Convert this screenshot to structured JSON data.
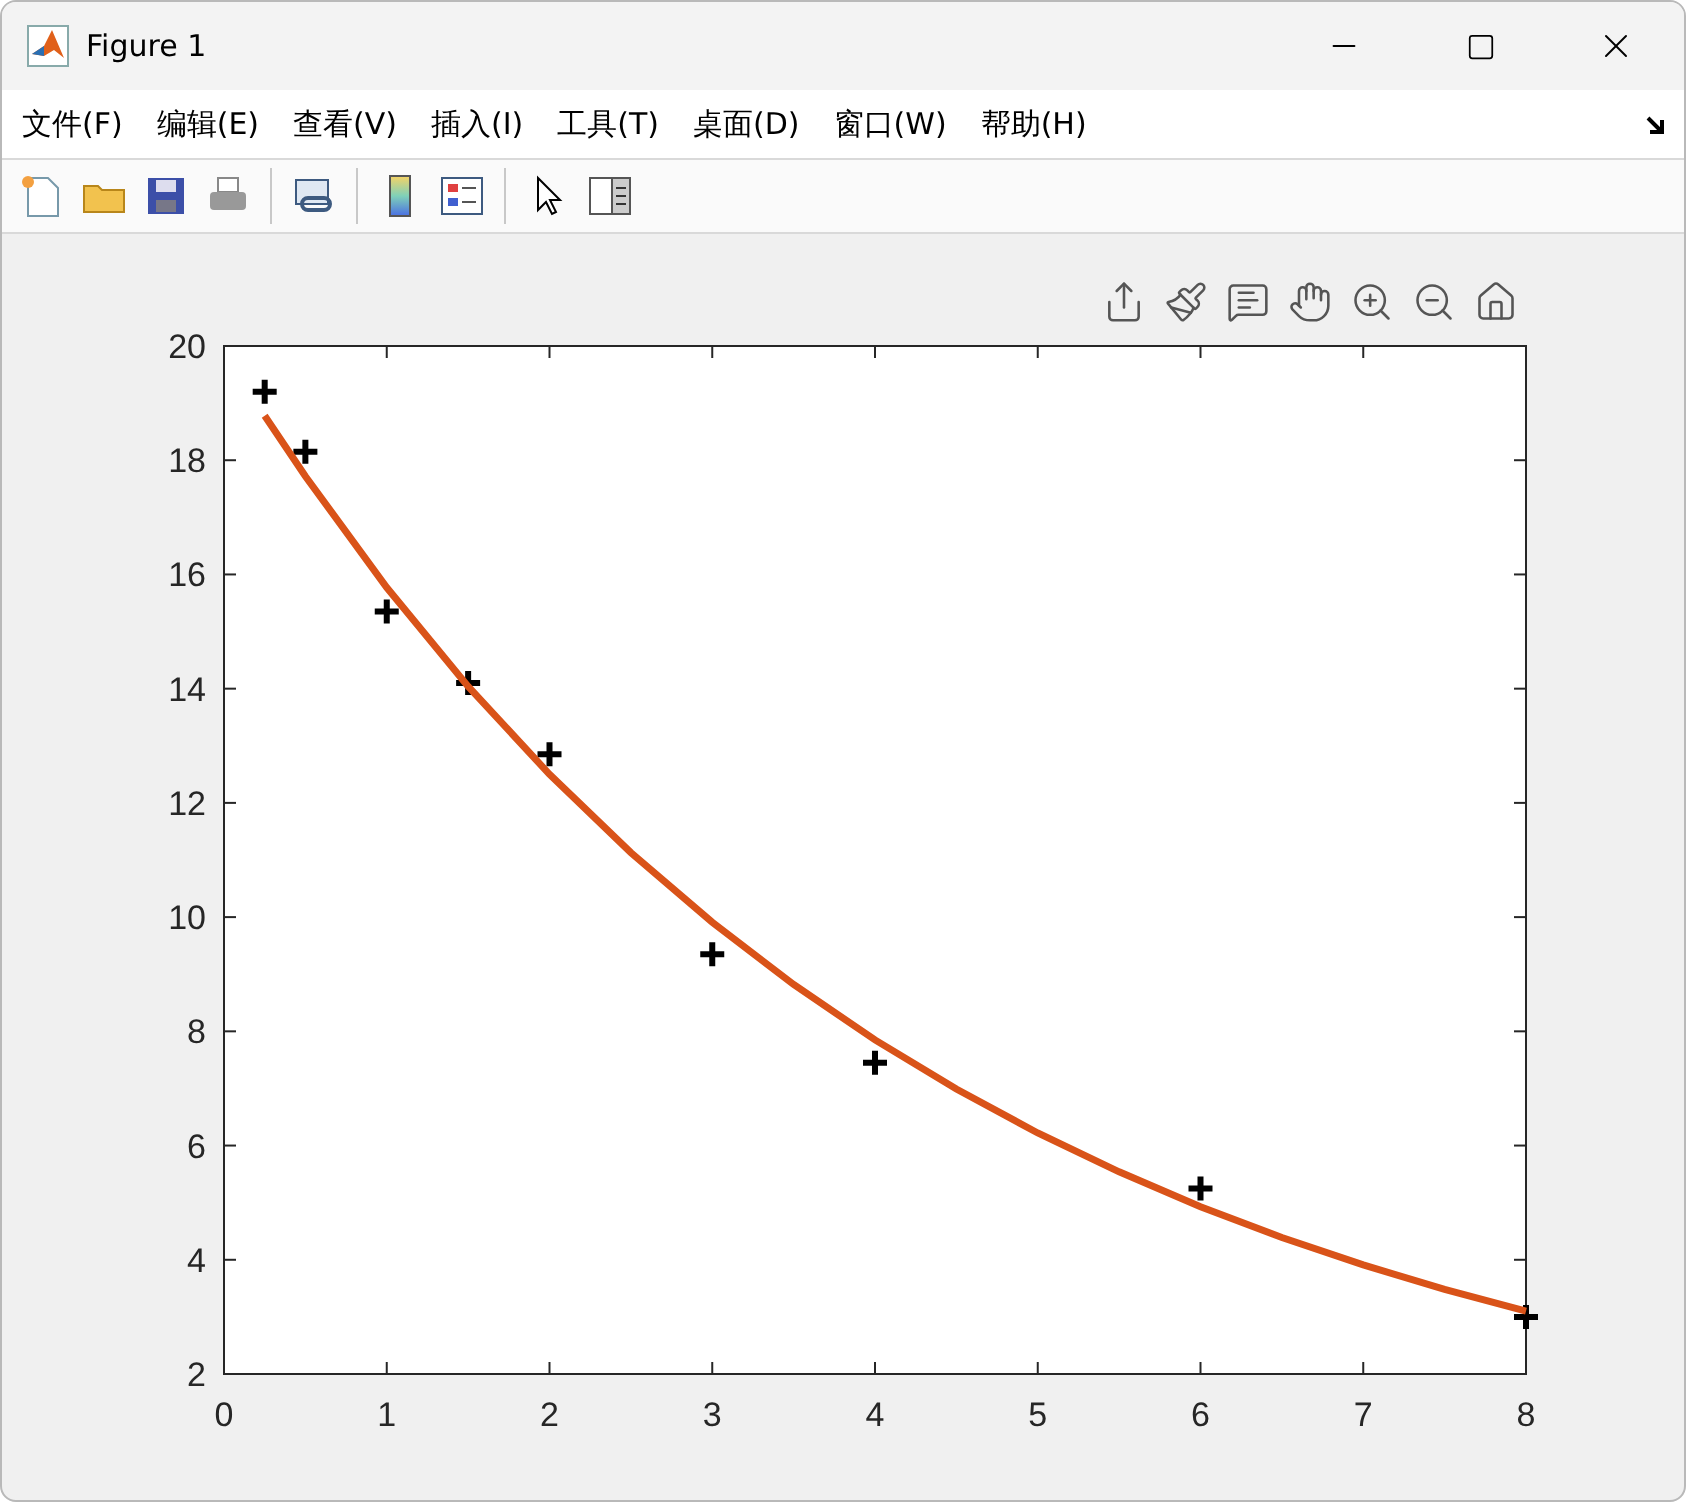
{
  "window": {
    "title": "Figure 1"
  },
  "menu": [
    "文件(F)",
    "编辑(E)",
    "查看(V)",
    "插入(I)",
    "工具(T)",
    "桌面(D)",
    "窗口(W)",
    "帮助(H)"
  ],
  "plot": {
    "chart_data": {
      "type": "scatter",
      "xlim": [
        0,
        8
      ],
      "ylim": [
        2,
        20
      ],
      "xticks": [
        0,
        1,
        2,
        3,
        4,
        5,
        6,
        7,
        8
      ],
      "yticks": [
        2,
        4,
        6,
        8,
        10,
        12,
        14,
        16,
        18,
        20
      ],
      "series": [
        {
          "color": "#000000",
          "x": [
            0.25,
            0.5,
            1,
            1.5,
            2,
            3,
            4,
            6,
            8
          ],
          "values": [
            19.2,
            18.15,
            15.35,
            14.1,
            12.85,
            9.35,
            7.45,
            5.25,
            3.0
          ]
        },
        {
          "type": "line",
          "color": "#d95319",
          "x": [
            0.25,
            0.5,
            1,
            1.5,
            2,
            2.5,
            3,
            3.5,
            4,
            4.5,
            5,
            5.5,
            6,
            6.5,
            7,
            7.5,
            8
          ],
          "values": [
            18.78,
            17.72,
            15.77,
            14.04,
            12.5,
            11.13,
            9.91,
            8.82,
            7.85,
            6.99,
            6.22,
            5.54,
            4.93,
            4.39,
            3.91,
            3.48,
            3.1
          ]
        }
      ]
    }
  }
}
